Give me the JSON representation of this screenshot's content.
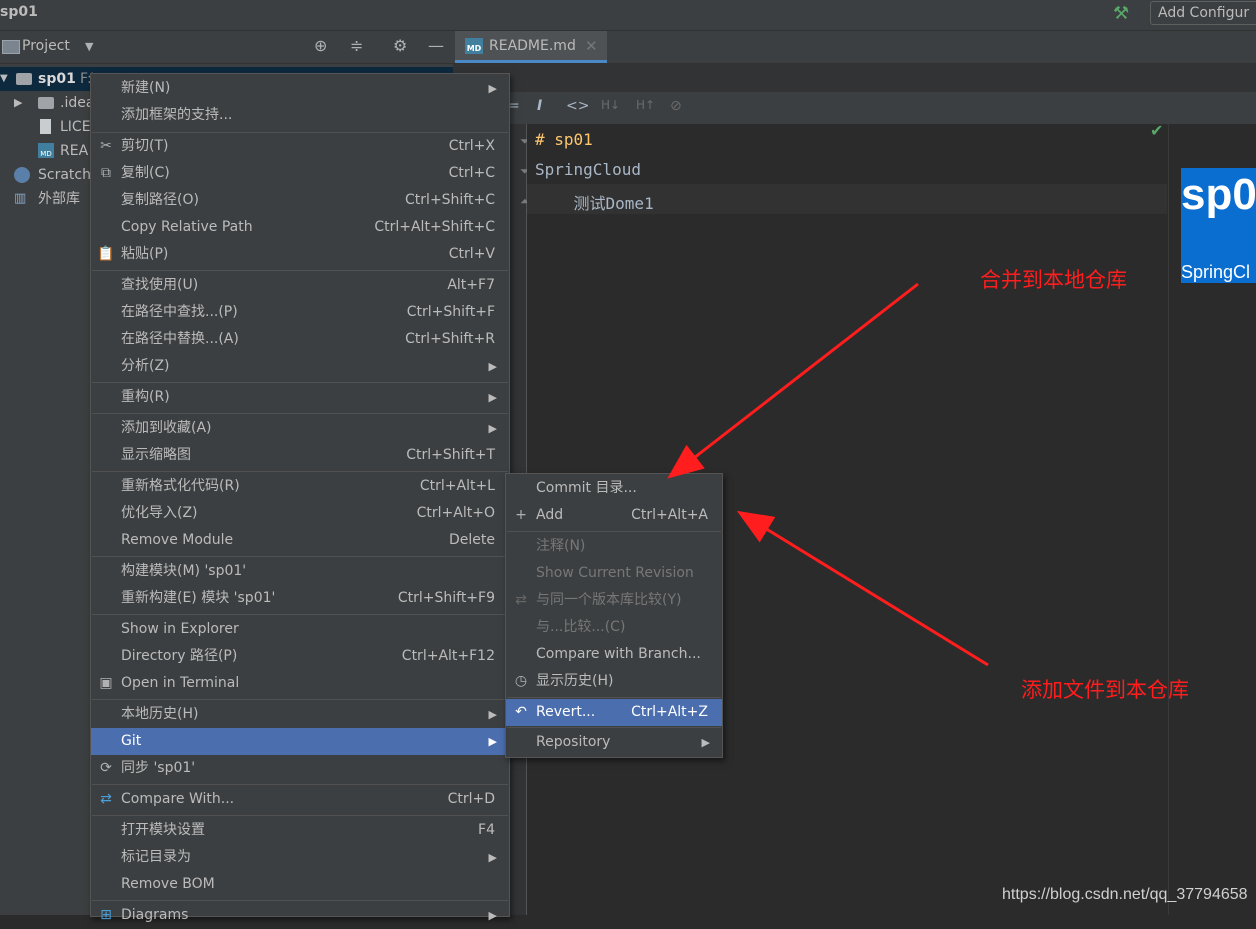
{
  "window": {
    "project_title": "sp01",
    "add_config": "Add Configur"
  },
  "project_panel": {
    "title": "Project",
    "tree": [
      {
        "label": "sp01",
        "extra": "F:\\...",
        "icon": "module-folder-icon"
      },
      {
        "label": ".idea",
        "icon": "folder-icon"
      },
      {
        "label": "LICE",
        "icon": "file-icon"
      },
      {
        "label": "REA",
        "icon": "markdown-file-icon"
      },
      {
        "label": "Scratch",
        "icon": "scratches-icon"
      },
      {
        "label": "外部库",
        "icon": "library-icon"
      }
    ]
  },
  "editor": {
    "tab": "README.md",
    "tab_icon": "MD",
    "lines": [
      "# sp01",
      "SpringCloud",
      "    测试Dome1"
    ],
    "preview": {
      "title": "sp0",
      "subtitle": "SpringCl"
    }
  },
  "context_menu": {
    "items": [
      {
        "label": "新建(N)",
        "submenu": true
      },
      {
        "label": "添加框架的支持..."
      },
      {
        "label": "剪切(T)",
        "shortcut": "Ctrl+X",
        "icon": "scissors-icon"
      },
      {
        "label": "复制(C)",
        "shortcut": "Ctrl+C",
        "icon": "copy-icon"
      },
      {
        "label": "复制路径(O)",
        "shortcut": "Ctrl+Shift+C"
      },
      {
        "label": "Copy Relative Path",
        "shortcut": "Ctrl+Alt+Shift+C"
      },
      {
        "label": "粘贴(P)",
        "shortcut": "Ctrl+V",
        "icon": "paste-icon"
      },
      {
        "label": "查找使用(U)",
        "shortcut": "Alt+F7"
      },
      {
        "label": "在路径中查找...(P)",
        "shortcut": "Ctrl+Shift+F"
      },
      {
        "label": "在路径中替换...(A)",
        "shortcut": "Ctrl+Shift+R"
      },
      {
        "label": "分析(Z)",
        "submenu": true
      },
      {
        "label": "重构(R)",
        "submenu": true
      },
      {
        "label": "添加到收藏(A)",
        "submenu": true
      },
      {
        "label": "显示缩略图",
        "shortcut": "Ctrl+Shift+T"
      },
      {
        "label": "重新格式化代码(R)",
        "shortcut": "Ctrl+Alt+L"
      },
      {
        "label": "优化导入(Z)",
        "shortcut": "Ctrl+Alt+O"
      },
      {
        "label": "Remove Module",
        "shortcut": "Delete"
      },
      {
        "label": "构建模块(M) 'sp01'"
      },
      {
        "label": "重新构建(E) 模块 'sp01'",
        "shortcut": "Ctrl+Shift+F9"
      },
      {
        "label": "Show in Explorer"
      },
      {
        "label": "Directory 路径(P)",
        "shortcut": "Ctrl+Alt+F12"
      },
      {
        "label": "Open in Terminal",
        "icon": "terminal-icon"
      },
      {
        "label": "本地历史(H)",
        "submenu": true
      },
      {
        "label": "Git",
        "submenu": true,
        "highlighted": true
      },
      {
        "label": "同步 'sp01'",
        "icon": "sync-icon"
      },
      {
        "label": "Compare With...",
        "shortcut": "Ctrl+D",
        "icon": "compare-icon"
      },
      {
        "label": "打开模块设置",
        "shortcut": "F4"
      },
      {
        "label": "标记目录为",
        "submenu": true
      },
      {
        "label": "Remove BOM"
      },
      {
        "label": "Diagrams",
        "submenu": true,
        "icon": "diagram-icon"
      }
    ]
  },
  "git_submenu": {
    "items": [
      {
        "label": "Commit 目录..."
      },
      {
        "label": "Add",
        "shortcut": "Ctrl+Alt+A",
        "icon": "plus-icon"
      },
      {
        "label": "注释(N)",
        "disabled": true
      },
      {
        "label": "Show Current Revision",
        "disabled": true
      },
      {
        "label": "与同一个版本库比较(Y)",
        "disabled": true,
        "icon": "compare-icon"
      },
      {
        "label": "与...比较...(C)",
        "disabled": true
      },
      {
        "label": "Compare with Branch..."
      },
      {
        "label": "显示历史(H)",
        "icon": "clock-icon"
      },
      {
        "label": "Revert...",
        "shortcut": "Ctrl+Alt+Z",
        "highlighted": true,
        "icon": "undo-icon"
      },
      {
        "label": "Repository",
        "submenu": true
      }
    ]
  },
  "annotations": {
    "commit_note": "合并到本地仓库",
    "add_note": "添加文件到本仓库",
    "arrow_color": "#ff1d1d"
  },
  "watermark": "https://blog.csdn.net/qq_37794658",
  "colors": {
    "menu_bg": "#3c3f41",
    "highlight": "#4b6eaf",
    "editor_bg": "#2b2b2b",
    "preview_blue": "#0a6ed1"
  }
}
